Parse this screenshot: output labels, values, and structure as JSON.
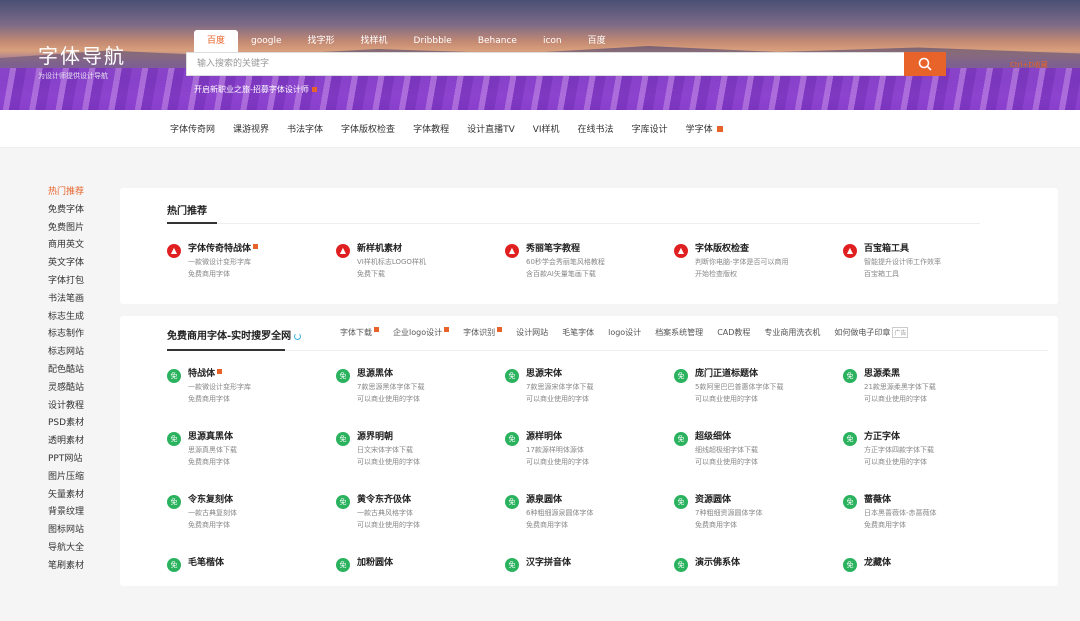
{
  "brand": {
    "title": "字体导航",
    "subtitle": "为设计师提供设计导航"
  },
  "search_tabs": [
    "百度",
    "google",
    "找字形",
    "找样机",
    "Dribbble",
    "Behance",
    "icon",
    "百度"
  ],
  "search": {
    "placeholder": "输入搜索的关键字"
  },
  "promo": "开启新职业之旅-招募字体设计师",
  "top_right": "Ctrl+D收藏",
  "nav": [
    "字体传奇网",
    "课游视界",
    "书法字体",
    "字体版权检查",
    "字体教程",
    "设计直播TV",
    "VI样机",
    "在线书法",
    "字库设计",
    "学字体"
  ],
  "sidebar": [
    "热门推荐",
    "免费字体",
    "免费图片",
    "商用英文",
    "英文字体",
    "字体打包",
    "书法笔画",
    "标志生成",
    "标志制作",
    "标志网站",
    "配色酷站",
    "灵感酷站",
    "设计教程",
    "PSD素材",
    "透明素材",
    "PPT网站",
    "图片压缩",
    "矢量素材",
    "背景纹理",
    "图标网站",
    "导航大全",
    "笔刷素材"
  ],
  "hot": {
    "title": "热门推荐",
    "items": [
      {
        "name": "字体传奇特战体",
        "desc": "一款微设计变形字库",
        "extra": "免费商用字体"
      },
      {
        "name": "新样机素材",
        "desc": "VI样机标志LOGO样机",
        "extra": "免费下载"
      },
      {
        "name": "秀丽笔字教程",
        "desc": "60秒学会秀丽笔风格教程",
        "extra": "含百款AI矢量笔画下载"
      },
      {
        "name": "字体版权检查",
        "desc": "判断你电脑-字体是否可以商用",
        "extra": "开始检查版权"
      },
      {
        "name": "百宝箱工具",
        "desc": "智能提升设计师工作效率",
        "extra": "百宝箱工具"
      }
    ]
  },
  "free": {
    "title": "免费商用字体-实时搜罗全网",
    "tabs": [
      "字体下载",
      "企业logo设计",
      "字体识别",
      "设计网站",
      "毛笔字体",
      "logo设计",
      "档案系统管理",
      "CAD教程",
      "专业商用洗衣机",
      "如何做电子印章"
    ],
    "ad_label": "广告",
    "icon_label": "免",
    "rows": [
      [
        {
          "name": "特战体",
          "desc": "一款微设计变形字库",
          "extra": "免费商用字体"
        },
        {
          "name": "思源黑体",
          "desc": "7款思源黑体字体下载",
          "extra": "可以商业使用的字体"
        },
        {
          "name": "思源宋体",
          "desc": "7款思源宋体字体下载",
          "extra": "可以商业使用的字体"
        },
        {
          "name": "庞门正道标题体",
          "desc": "5款阿里巴巴普惠体字体下载",
          "extra": "可以商业使用的字体"
        },
        {
          "name": "思源柔黑",
          "desc": "21款思源柔黑字体下载",
          "extra": "可以商业使用的字体"
        }
      ],
      [
        {
          "name": "思源真黑体",
          "desc": "思源真黑体下载",
          "extra": "免费商用字体"
        },
        {
          "name": "源界明朝",
          "desc": "日文宋体字体下载",
          "extra": "可以商业使用的字体"
        },
        {
          "name": "源样明体",
          "desc": "17款源样明体源体",
          "extra": "可以商业使用的字体"
        },
        {
          "name": "超级细体",
          "desc": "细线超极细字体下载",
          "extra": "可以商业使用的字体"
        },
        {
          "name": "方正字体",
          "desc": "方正字体四款字体下载",
          "extra": "可以商业使用的字体"
        }
      ],
      [
        {
          "name": "令东复刻体",
          "desc": "一款古典复刻体",
          "extra": "免费商用字体"
        },
        {
          "name": "黄令东齐伋体",
          "desc": "一款古典风格字体",
          "extra": "可以商业使用的字体"
        },
        {
          "name": "源泉圆体",
          "desc": "6种粗细源泉圆体字体",
          "extra": "免费商用字体"
        },
        {
          "name": "资源圆体",
          "desc": "7种粗细资源圆体字体",
          "extra": "免费商用字体"
        },
        {
          "name": "蔷薇体",
          "desc": "日本黑蔷薇体-赤蔷薇体",
          "extra": "免费商用字体"
        }
      ],
      [
        {
          "name": "毛笔楷体",
          "desc": "",
          "extra": ""
        },
        {
          "name": "加粉圆体",
          "desc": "",
          "extra": ""
        },
        {
          "name": "汉字拼音体",
          "desc": "",
          "extra": ""
        },
        {
          "name": "演示佛系体",
          "desc": "",
          "extra": ""
        },
        {
          "name": "龙藏体",
          "desc": "",
          "extra": ""
        }
      ]
    ]
  },
  "colors": {
    "accent": "#e8632a",
    "hot_icon": "#e02020",
    "free_icon": "#2ab25e"
  }
}
